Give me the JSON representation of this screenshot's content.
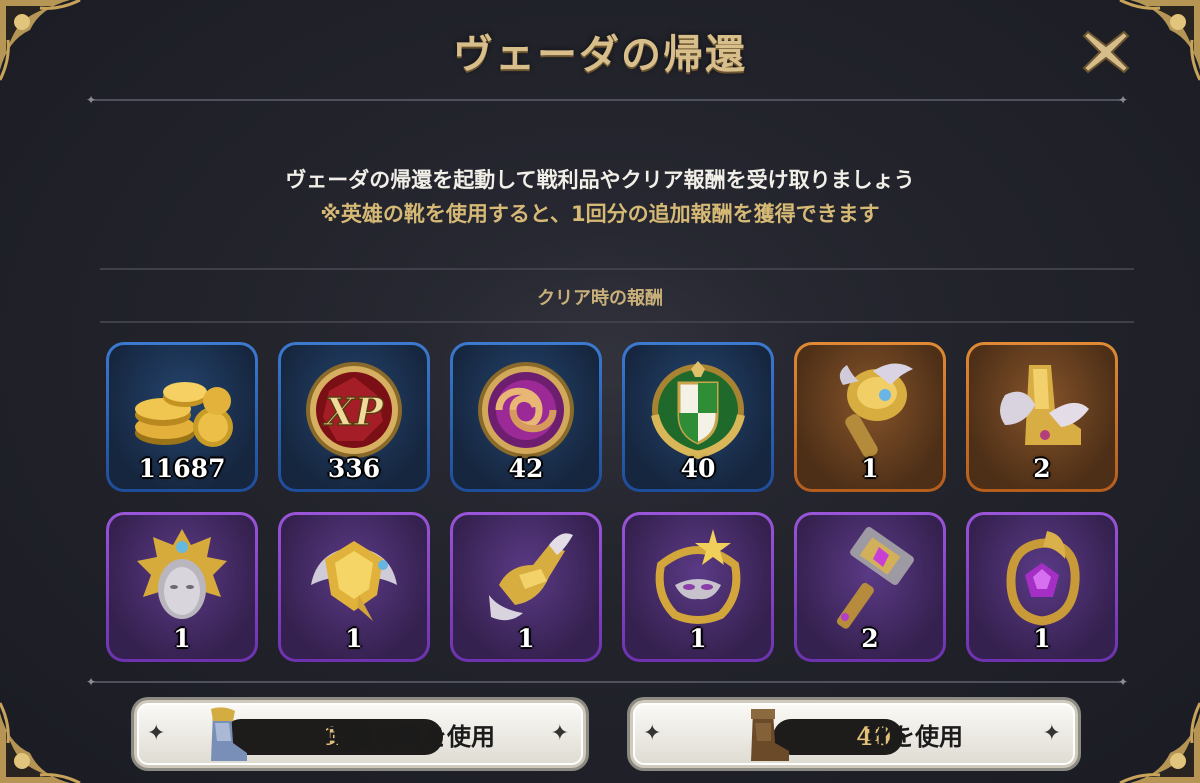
{
  "dialog": {
    "title": "ヴェーダの帰還",
    "description": "ヴェーダの帰還を起動して戦利品やクリア報酬を受け取りましょう",
    "note": "※英雄の靴を使用すると、1回分の追加報酬を獲得できます",
    "section_label": "クリア時の報酬",
    "close_icon": "close-icon"
  },
  "rewards": [
    {
      "name": "gold-coins",
      "rarity": "blue",
      "quantity": "11687",
      "icon": "gold-coins-icon"
    },
    {
      "name": "xp-orb",
      "rarity": "blue",
      "quantity": "336",
      "icon": "xp-icon"
    },
    {
      "name": "bond-token",
      "rarity": "blue",
      "quantity": "42",
      "icon": "knot-token-icon"
    },
    {
      "name": "guild-emblem",
      "rarity": "blue",
      "quantity": "40",
      "icon": "shield-emblem-icon"
    },
    {
      "name": "gold-mace",
      "rarity": "orange",
      "quantity": "1",
      "icon": "mace-icon"
    },
    {
      "name": "gold-boots",
      "rarity": "orange",
      "quantity": "2",
      "icon": "boots-icon"
    },
    {
      "name": "sun-helmet",
      "rarity": "purple",
      "quantity": "1",
      "icon": "helmet-icon"
    },
    {
      "name": "gold-pauldron",
      "rarity": "purple",
      "quantity": "1",
      "icon": "pauldron-icon"
    },
    {
      "name": "gold-gauntlet",
      "rarity": "purple",
      "quantity": "1",
      "icon": "gauntlet-icon"
    },
    {
      "name": "star-mask",
      "rarity": "purple",
      "quantity": "1",
      "icon": "mask-icon"
    },
    {
      "name": "gem-hammer",
      "rarity": "purple",
      "quantity": "2",
      "icon": "hammer-icon"
    },
    {
      "name": "gem-amulet",
      "rarity": "purple",
      "quantity": "1",
      "icon": "amulet-icon"
    }
  ],
  "buttons": {
    "hero_boots": {
      "count": "1",
      "label": "英雄の靴を使用",
      "icon": "hero-boots-icon"
    },
    "boots": {
      "count": "40",
      "label": "靴を使用",
      "icon": "boots-icon"
    }
  },
  "colors": {
    "gold": "#d8be8a",
    "blue_frame": "#3c7ad0",
    "orange_frame": "#e08a36",
    "purple_frame": "#9a55d8"
  }
}
